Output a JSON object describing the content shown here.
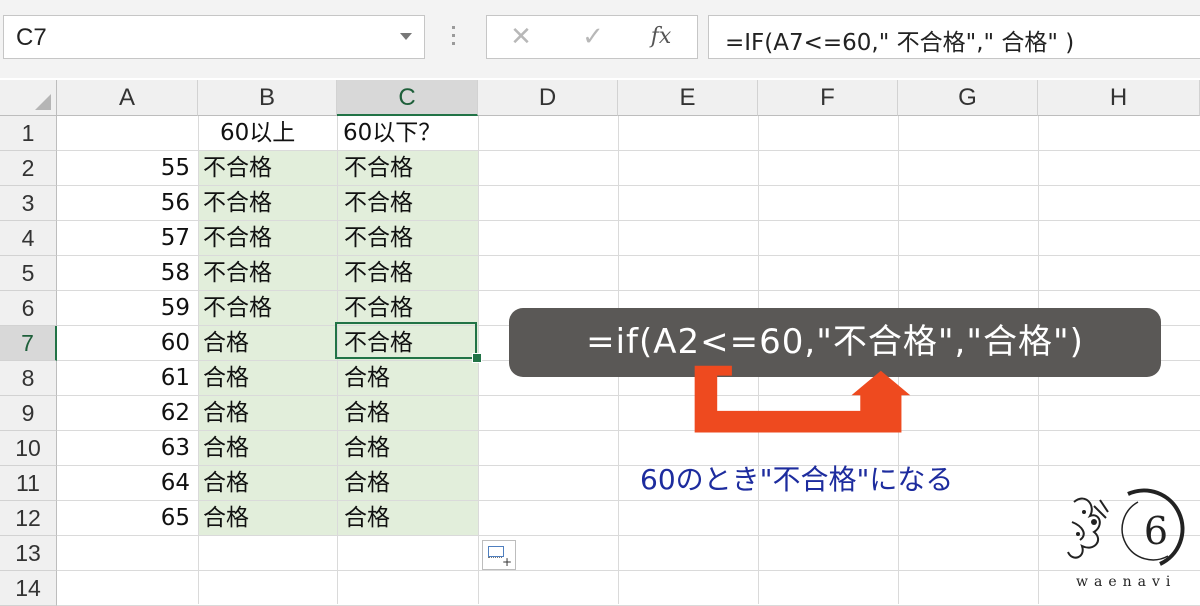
{
  "formula_bar": {
    "name_box": "C7",
    "cancel_glyph": "✕",
    "enter_glyph": "✓",
    "fx_label": "fx",
    "formula": "=IF(A7<=60,\" 不合格\",\" 合格\" )"
  },
  "columns": [
    "A",
    "B",
    "C",
    "D",
    "E",
    "F",
    "G",
    "H"
  ],
  "selected_column": "C",
  "rows": [
    "1",
    "2",
    "3",
    "4",
    "5",
    "6",
    "7",
    "8",
    "9",
    "10",
    "11",
    "12",
    "13",
    "14"
  ],
  "selected_row": "7",
  "header_row": {
    "b": "60以上",
    "c": "60以下？"
  },
  "data_rows": [
    {
      "a": "55",
      "b": "不合格",
      "c": "不合格"
    },
    {
      "a": "56",
      "b": "不合格",
      "c": "不合格"
    },
    {
      "a": "57",
      "b": "不合格",
      "c": "不合格"
    },
    {
      "a": "58",
      "b": "不合格",
      "c": "不合格"
    },
    {
      "a": "59",
      "b": "不合格",
      "c": "不合格"
    },
    {
      "a": "60",
      "b": "合格",
      "c": "不合格"
    },
    {
      "a": "61",
      "b": "合格",
      "c": "合格"
    },
    {
      "a": "62",
      "b": "合格",
      "c": "合格"
    },
    {
      "a": "63",
      "b": "合格",
      "c": "合格"
    },
    {
      "a": "64",
      "b": "合格",
      "c": "合格"
    },
    {
      "a": "65",
      "b": "合格",
      "c": "合格"
    }
  ],
  "active_cell": "C7",
  "callout": {
    "formula": "=if(A2<=60,\"不合格\",\"合格\")"
  },
  "annotation": "60のとき\"不合格\"になる",
  "logo": {
    "brand": "waenavi",
    "mark": "6"
  },
  "colors": {
    "accent": "#217346",
    "range_fill": "#e2eedb",
    "callout_bg": "#5a5856",
    "arrow": "#ee4a1f",
    "annotation_text": "#1d2c9e"
  },
  "icons": {
    "name_box_dropdown": "chevron-down-icon",
    "quick_analysis": "quick-analysis-icon"
  }
}
